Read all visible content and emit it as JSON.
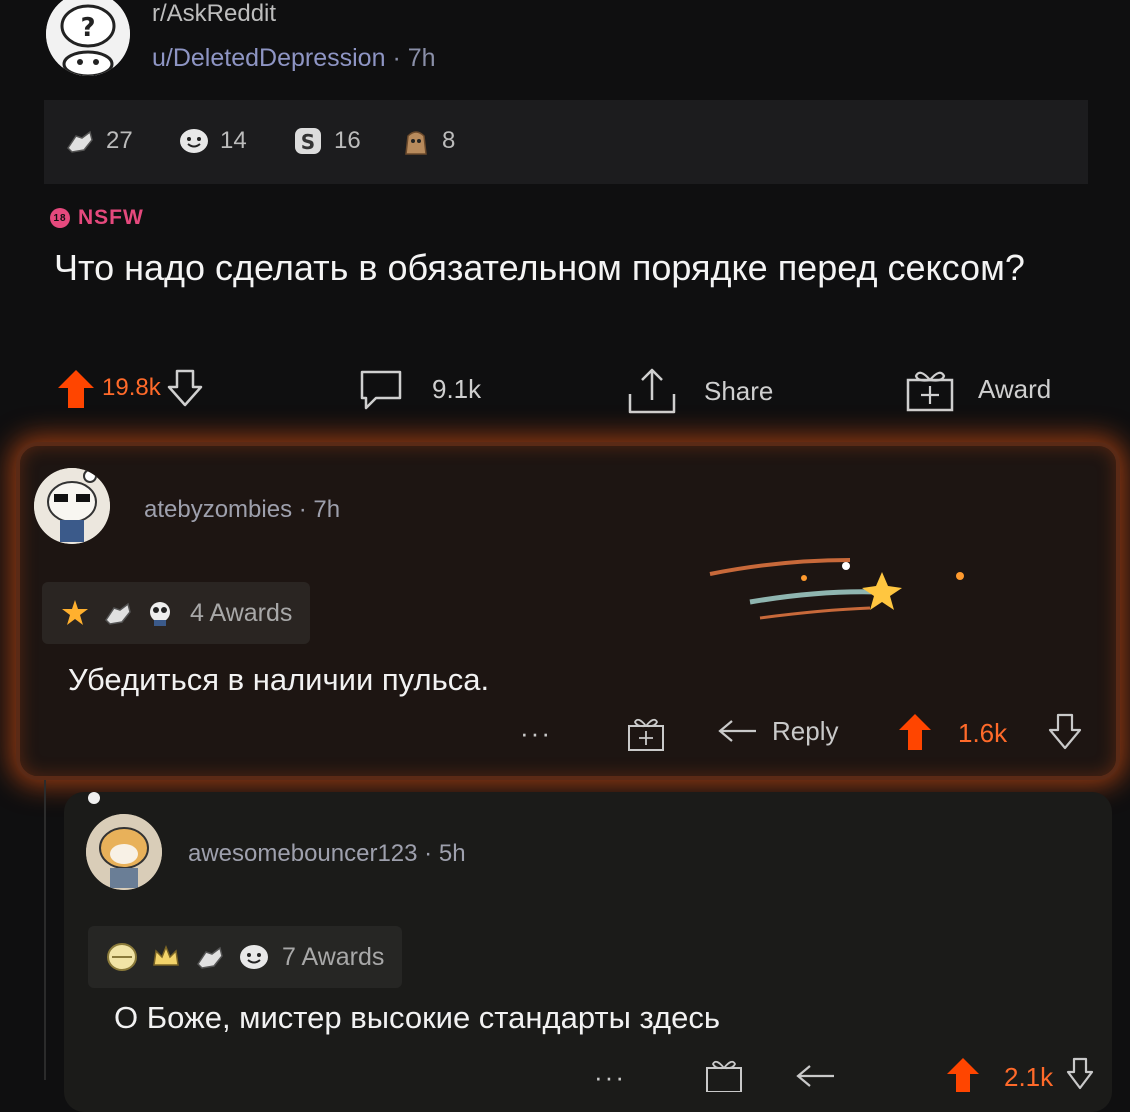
{
  "post": {
    "subreddit": "r/AskReddit",
    "author": "u/DeletedDepression",
    "separator": "·",
    "age": "7h",
    "awards": [
      {
        "icon": "helpful-hands-icon",
        "count": "27"
      },
      {
        "icon": "wholesome-face-icon",
        "count": "14"
      },
      {
        "icon": "silver-coin-icon",
        "count": "16"
      },
      {
        "icon": "bag-award-icon",
        "count": "8"
      }
    ],
    "nsfw_badge": "18",
    "nsfw_label": "NSFW",
    "title": "Что надо сделать в обязательном порядке перед сексом?",
    "upvotes": "19.8k",
    "comments": "9.1k",
    "share_label": "Share",
    "award_label": "Award"
  },
  "comments": [
    {
      "author": "atebyzombies",
      "separator": "·",
      "age": "7h",
      "awards_label": "4 Awards",
      "body": "Убедиться в наличии пульса.",
      "more": "···",
      "reply_label": "Reply",
      "votes": "1.6k"
    },
    {
      "author": "awesomebouncer123",
      "separator": "·",
      "age": "5h",
      "awards_label": "7 Awards",
      "body": "О Боже, мистер высокие стандарты здесь",
      "more": "···",
      "votes": "2.1k"
    }
  ],
  "colors": {
    "background": "#0f0f10",
    "upvote": "#ff4500",
    "nsfw": "#e5497d",
    "highlight_glow": "#ff5c14"
  }
}
